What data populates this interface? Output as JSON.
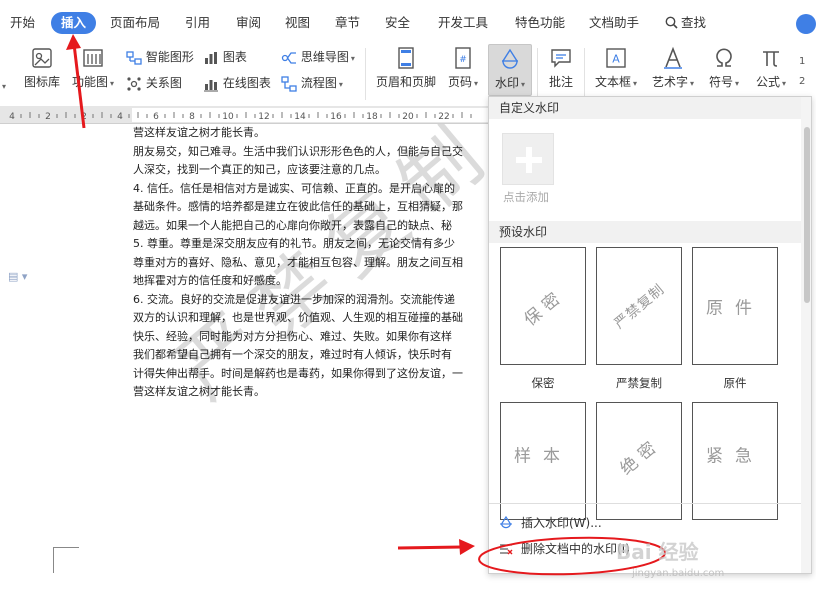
{
  "menu": {
    "tabs": [
      "开始",
      "插入",
      "页面布局",
      "引用",
      "审阅",
      "视图",
      "章节",
      "安全",
      "开发工具",
      "特色功能",
      "文档助手"
    ],
    "active": "插入",
    "search_label": "查找"
  },
  "ribbon": {
    "iconlib": "图标库",
    "funcchart": "功能图",
    "smartart": "智能图形",
    "relation": "关系图",
    "chart": "图表",
    "online_chart": "在线图表",
    "mindmap": "思维导图",
    "flowchart": "流程图",
    "header_footer": "页眉和页脚",
    "page_number": "页码",
    "watermark": "水印",
    "comment": "批注",
    "textbox": "文本框",
    "wordart": "艺术字",
    "symbol": "符号",
    "formula": "公式"
  },
  "ruler": {
    "marks": [
      "4",
      "2",
      "2",
      "4",
      "6",
      "8",
      "10",
      "12",
      "14",
      "16",
      "18",
      "20",
      "22"
    ]
  },
  "document": {
    "lines": [
      "营这样友谊之树才能长青。",
      "朋友易交，知己难寻。生活中我们认识形形色色的人，但能与自己交",
      "人深交，找到一个真正的知己，应该要注意的几点。",
      "4.  信任。信任是相信对方是诚实、可信赖、正直的。是开启心扉的",
      "基础条件。感情的培养都是建立在彼此信任的基础上，互相猜疑，那",
      "越远。如果一个人能把自己的心扉向你敞开，表露自己的缺点、秘",
      "5.  尊重。尊重是深交朋友应有的礼节。朋友之间，无论交情有多少",
      "尊重对方的喜好、隐私、意见，才能相互包容、理解。朋友之间互相",
      "地挥霍对方的信任度和好感度。",
      "6.  交流。良好的交流是促进友谊进一步加深的润滑剂。交流能传递",
      "双方的认识和理解，也是世界观、价值观、人生观的相互碰撞的基础",
      "快乐、经验，同时能为对方分担伤心、难过、失败。如果你有这样",
      "    我们都希望自己拥有一个深交的朋友，难过时有人倾诉，快乐时有",
      "计得失伸出帮手。时间是解药也是毒药，如果你得到了这份友谊，一",
      "营这样友谊之树才能长青。"
    ],
    "watermark_text": "严禁复制"
  },
  "watermark_panel": {
    "custom_section": "自定义水印",
    "add_label": "点击添加",
    "preset_section": "预设水印",
    "presets": [
      {
        "text": "保密",
        "label": "保密",
        "style": "diag"
      },
      {
        "text": "严禁复制",
        "label": "严禁复制",
        "style": "diag-small"
      },
      {
        "text": "原件",
        "label": "原件",
        "style": "flat"
      },
      {
        "text": "样本",
        "label": "",
        "style": "flat"
      },
      {
        "text": "绝密",
        "label": "",
        "style": "diag"
      },
      {
        "text": "紧急",
        "label": "",
        "style": "flat"
      }
    ],
    "insert_watermark": "插入水印(W)...",
    "delete_watermark": "删除文档中的水印(I)"
  },
  "overlay": {
    "baidu_mark": "Bai 经验",
    "baidu_url": "jingyan.baidu.com"
  },
  "colors": {
    "accent": "#3f7fe5",
    "annotation_red": "#e5191d"
  }
}
